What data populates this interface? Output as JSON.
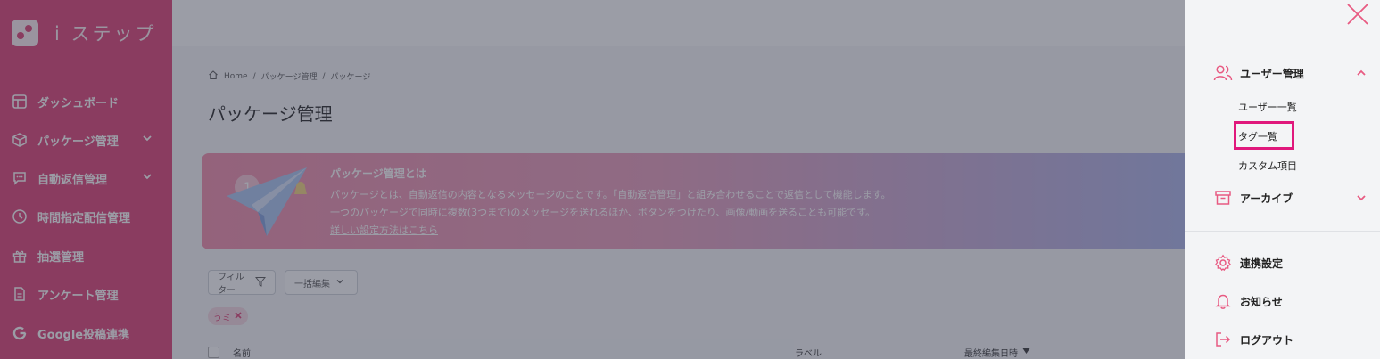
{
  "app": {
    "logo_text": "i ステップ"
  },
  "sidebar": {
    "items": [
      {
        "label": "ダッシュボード",
        "icon": "dashboard-icon"
      },
      {
        "label": "パッケージ管理",
        "icon": "package-icon"
      },
      {
        "label": "自動返信管理",
        "icon": "chat-icon"
      },
      {
        "label": "時間指定配信管理",
        "icon": "clock-icon"
      },
      {
        "label": "抽選管理",
        "icon": "gift-icon"
      },
      {
        "label": "アンケート管理",
        "icon": "document-icon"
      },
      {
        "label": "Google投稿連携",
        "icon": "google-icon"
      }
    ]
  },
  "breadcrumb": [
    "Home",
    "/",
    "パッケージ管理",
    "/",
    "パッケージ"
  ],
  "page_title": "パッケージ管理",
  "banner": {
    "title": "パッケージ管理とは",
    "line1": "パッケージとは、自動返信の内容となるメッセージのことです。「自動返信管理」と組み合わせることで返信として機能します。",
    "line2": "一つのパッケージで同時に複数(3つまで)のメッセージを送れるほか、ボタンをつけたり、画像/動画を送ることも可能です。",
    "link": "詳しい設定方法はこちら"
  },
  "toolbar": {
    "filter_label": "フィルター",
    "bulk_edit_label": "一括編集"
  },
  "filter_chip": {
    "label": "うミ"
  },
  "table": {
    "headers": [
      "名前",
      "ラベル",
      "最終編集日時"
    ]
  },
  "drawer": {
    "user_management": "ユーザー管理",
    "sub_items": [
      "ユーザー一覧",
      "タグ一覧",
      "カスタム項目"
    ],
    "archive": "アーカイブ",
    "integration": "連携設定",
    "notifications": "お知らせ",
    "logout": "ログアウト"
  },
  "colors": {
    "accent": "#dd3d72",
    "highlight": "#e0187c",
    "overlay": "#373c4e"
  }
}
